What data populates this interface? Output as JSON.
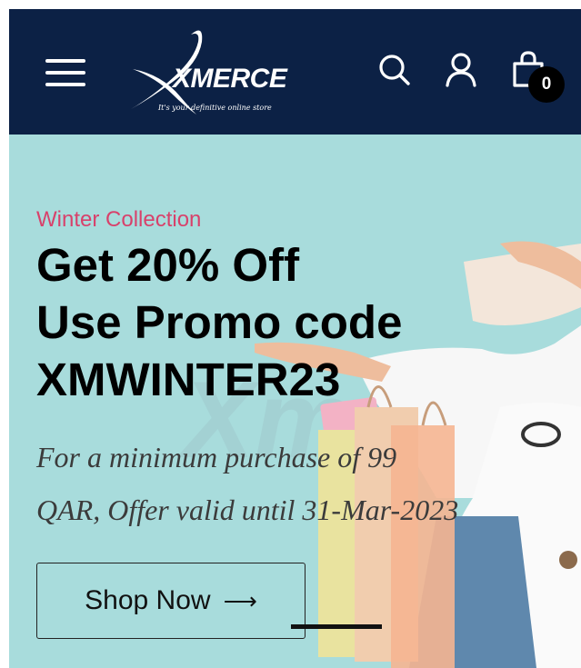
{
  "header": {
    "background": "#0c2145",
    "menu_icon": "hamburger-menu-icon",
    "logo": {
      "name": "XMERCE",
      "tagline": "It's your definitive online store"
    },
    "search_icon": "search-icon",
    "account_icon": "user-icon",
    "cart_icon": "shopping-bag-icon",
    "cart_count": "0"
  },
  "hero": {
    "background": "#a8dcdc",
    "eyebrow": "Winter Collection",
    "eyebrow_color": "#d8416b",
    "headline": [
      "Get 20% Off",
      "Use Promo code",
      "XMWINTER23"
    ],
    "subtext": [
      "For a minimum purchase of 99",
      "QAR, Offer valid until 31-Mar-2023"
    ],
    "cta": {
      "label": "Shop Now",
      "arrow": "⟶"
    },
    "image_alt": "woman-with-shopping-bags-image"
  }
}
